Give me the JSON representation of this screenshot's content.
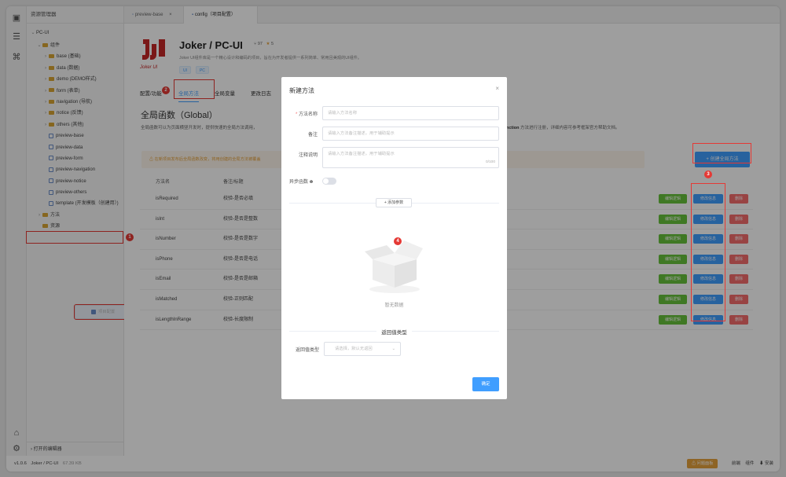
{
  "explorer": {
    "title": "资源管理器",
    "root": "PC-UI",
    "tree": [
      {
        "label": "组件",
        "kind": "folder",
        "depth": 1,
        "expanded": true
      },
      {
        "label": "base (基础)",
        "kind": "folder",
        "depth": 2
      },
      {
        "label": "data (数据)",
        "kind": "folder",
        "depth": 2
      },
      {
        "label": "demo (DEMO样式)",
        "kind": "folder",
        "depth": 2
      },
      {
        "label": "form (表单)",
        "kind": "folder",
        "depth": 2
      },
      {
        "label": "navigation (导航)",
        "kind": "folder",
        "depth": 2
      },
      {
        "label": "notice (反馈)",
        "kind": "folder",
        "depth": 2
      },
      {
        "label": "others (其他)",
        "kind": "folder",
        "depth": 2
      },
      {
        "label": "preview-base",
        "kind": "file",
        "depth": 2
      },
      {
        "label": "preview-data",
        "kind": "file",
        "depth": 2
      },
      {
        "label": "preview-form",
        "kind": "file",
        "depth": 2
      },
      {
        "label": "preview-navigation",
        "kind": "file",
        "depth": 2
      },
      {
        "label": "preview-notice",
        "kind": "file",
        "depth": 2
      },
      {
        "label": "preview-others",
        "kind": "file",
        "depth": 2
      },
      {
        "label": "template (开发模板（创建用）)",
        "kind": "file",
        "depth": 2
      },
      {
        "label": "方法",
        "kind": "folder",
        "depth": 1
      },
      {
        "label": "资源",
        "kind": "folder",
        "depth": 1,
        "noarrow": true
      },
      {
        "label": "项目配置",
        "kind": "config",
        "depth": 1,
        "selected": true
      }
    ],
    "open_editors": "打开的编辑器"
  },
  "tabs": [
    {
      "label": "preview-base",
      "close": "×"
    },
    {
      "label": "config（项目配置）",
      "active": true
    }
  ],
  "project": {
    "logo_caption": "Joker UI",
    "title": "Joker / PC-UI",
    "forks": "97",
    "stars": "5",
    "description": "Joker UI组件库是一个精心设计和编码的项目，旨在为开发者提供一系列简单、常用且美观的UI组件。",
    "tags": [
      "UI",
      "PC"
    ]
  },
  "nav_tabs": [
    "配置/功能",
    "全局方法",
    "全局变量",
    "更改日志"
  ],
  "section": {
    "title": "全局函数（Global）",
    "desc_left": "全局函数可以为页面横竖开发时，提供快速的全局方法调用，",
    "desc_right_bold": "nction",
    "desc_right": " 方法进行注册，详细内容可参考框架官方帮助文档。",
    "warning": "在新项目发布后全局函数改变，将用创建的全局方法被覆盖",
    "create_button": "创建全局方法",
    "col_name": "方法名",
    "col_note": "备注/标题"
  },
  "methods": [
    {
      "name": "isRequired",
      "note": "校验-是否必填"
    },
    {
      "name": "isInt",
      "note": "校验-是否是整数"
    },
    {
      "name": "isNumber",
      "note": "校验-是否是数字"
    },
    {
      "name": "isPhone",
      "note": "校验-是否是电话"
    },
    {
      "name": "isEmail",
      "note": "校验-是否是邮箱"
    },
    {
      "name": "isMatched",
      "note": "校验-正则匹配"
    },
    {
      "name": "isLengthInRange",
      "note": "校验-长度限制"
    }
  ],
  "row_actions": {
    "edit_logic": "编辑逻辑",
    "edit_info": "修改信息",
    "delete": "删除"
  },
  "modal": {
    "title": "新建方法",
    "close": "×",
    "name_label": "方法名称",
    "name_placeholder": "请输入方法名称",
    "note_label": "备注",
    "note_placeholder": "请输入方法备注描述，用于辅助提示",
    "comment_label": "注释说明",
    "comment_placeholder": "请输入方法备注描述，用于辅助提示",
    "comment_count": "0/100",
    "async_label": "异步函数",
    "add_param": "添加参数",
    "empty_text": "暂无数据",
    "return_title": "返回值类型",
    "return_label": "返回值类型",
    "return_placeholder": "请选择，默认无返回",
    "ok": "确定"
  },
  "annotations": [
    "1",
    "2",
    "3",
    "4"
  ],
  "statusbar": {
    "version": "v1.0.6",
    "project": "Joker / PC-UI",
    "size": "67.39 KB",
    "problems": "问题面板",
    "frontend": "前端",
    "components": "组件",
    "install": "安装"
  },
  "colors": {
    "primary": "#409eff",
    "success": "#67c23a",
    "danger": "#f56c6c",
    "annotation": "#e53935",
    "warning": "#e6a23c"
  }
}
